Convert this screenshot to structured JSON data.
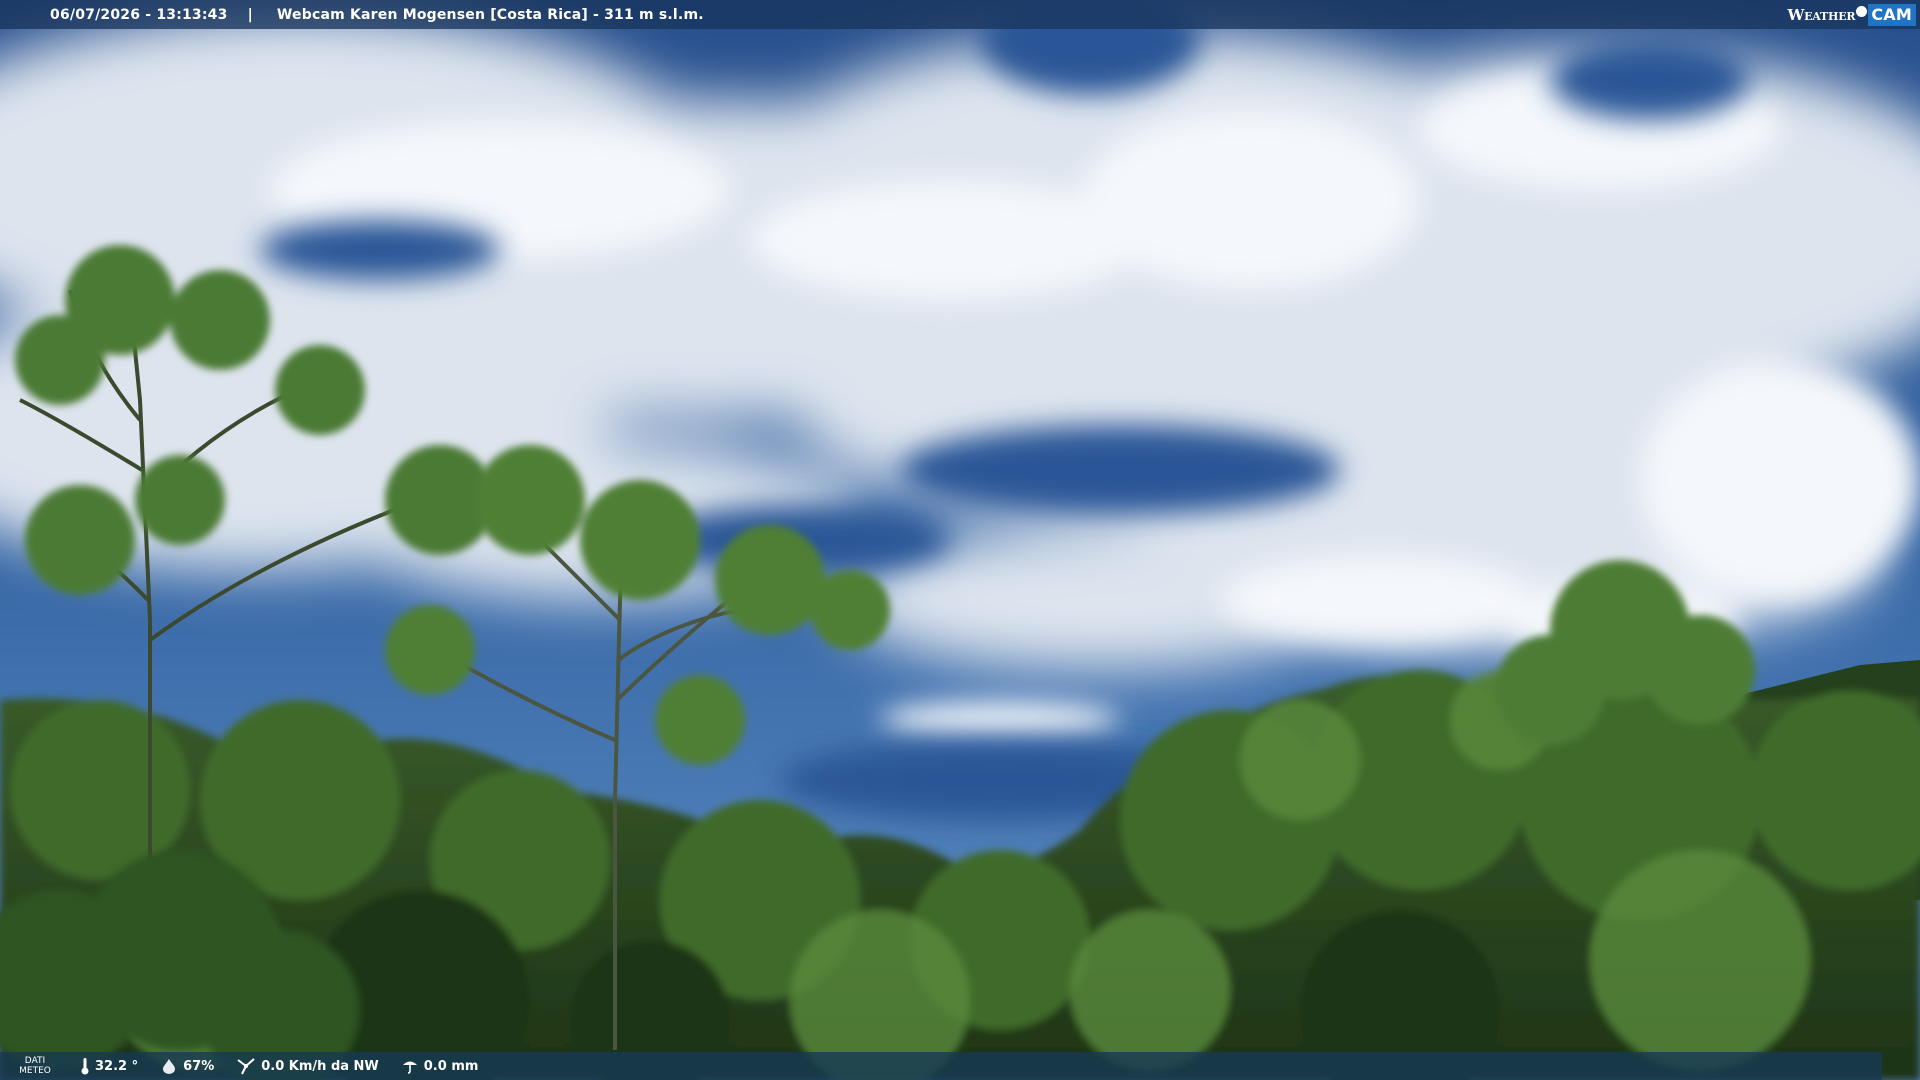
{
  "header": {
    "timestamp": "06/07/2026 - 13:13:43",
    "separator": "|",
    "title": "Webcam Karen Mogensen [Costa Rica] - 311 m s.l.m.",
    "logo_word1": "Weather",
    "logo_word2": "CAM"
  },
  "footer": {
    "label_line1": "DATI",
    "label_line2": "METEO",
    "temperature": "32.2 °",
    "humidity": "67%",
    "wind": "0.0 Km/h da NW",
    "rain": "0.0 mm"
  },
  "icons": {
    "temperature": "thermometer-icon",
    "humidity": "drop-icon",
    "wind": "wind-icon",
    "rain": "rain-icon"
  },
  "colors": {
    "sky": "#2f5e9e",
    "cloud": "#e9eef4",
    "forest": "#2c4a1e",
    "logo_accent": "#1f74c4"
  }
}
